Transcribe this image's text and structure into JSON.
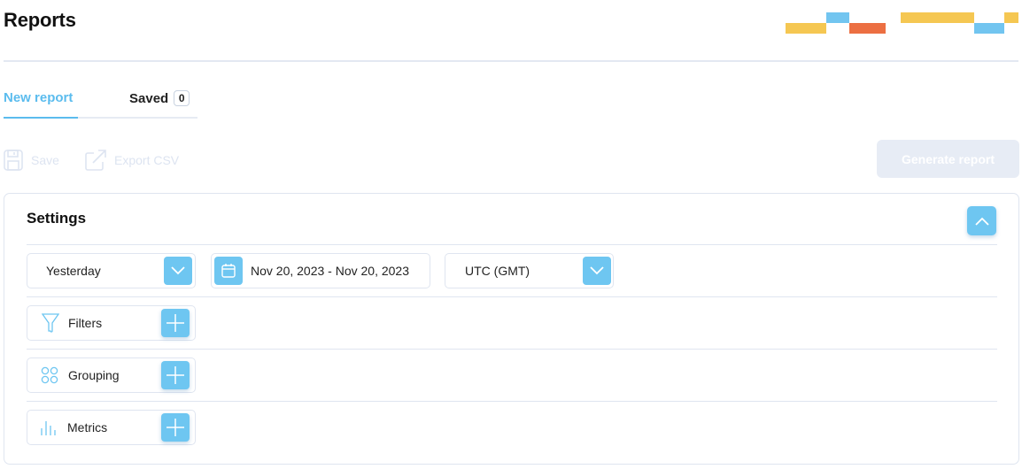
{
  "header": {
    "title": "Reports"
  },
  "tabs": [
    {
      "label": "New report",
      "active": true
    },
    {
      "label": "Saved",
      "count": "0",
      "active": false
    }
  ],
  "toolbar": {
    "save_label": "Save",
    "export_label": "Export CSV",
    "generate_label": "Generate report"
  },
  "settings": {
    "title": "Settings",
    "period": {
      "value": "Yesterday",
      "icon": "chevron-down-icon"
    },
    "date_range": {
      "value": "Nov 20, 2023 - Nov 20, 2023",
      "icon": "calendar-icon"
    },
    "timezone": {
      "value": "UTC (GMT)",
      "icon": "chevron-down-icon"
    },
    "filters": {
      "label": "Filters",
      "icon": "funnel-icon"
    },
    "grouping": {
      "label": "Grouping",
      "icon": "grid-circles-icon"
    },
    "metrics": {
      "label": "Metrics",
      "icon": "bar-chart-icon"
    }
  },
  "colors": {
    "accent": "#6ec6f1",
    "accent_text": "#5bbcee",
    "deco_yellow": "#f5c752",
    "deco_blue": "#72c5f0",
    "deco_orange": "#ec6f42",
    "disabled": "#dde4f1"
  }
}
